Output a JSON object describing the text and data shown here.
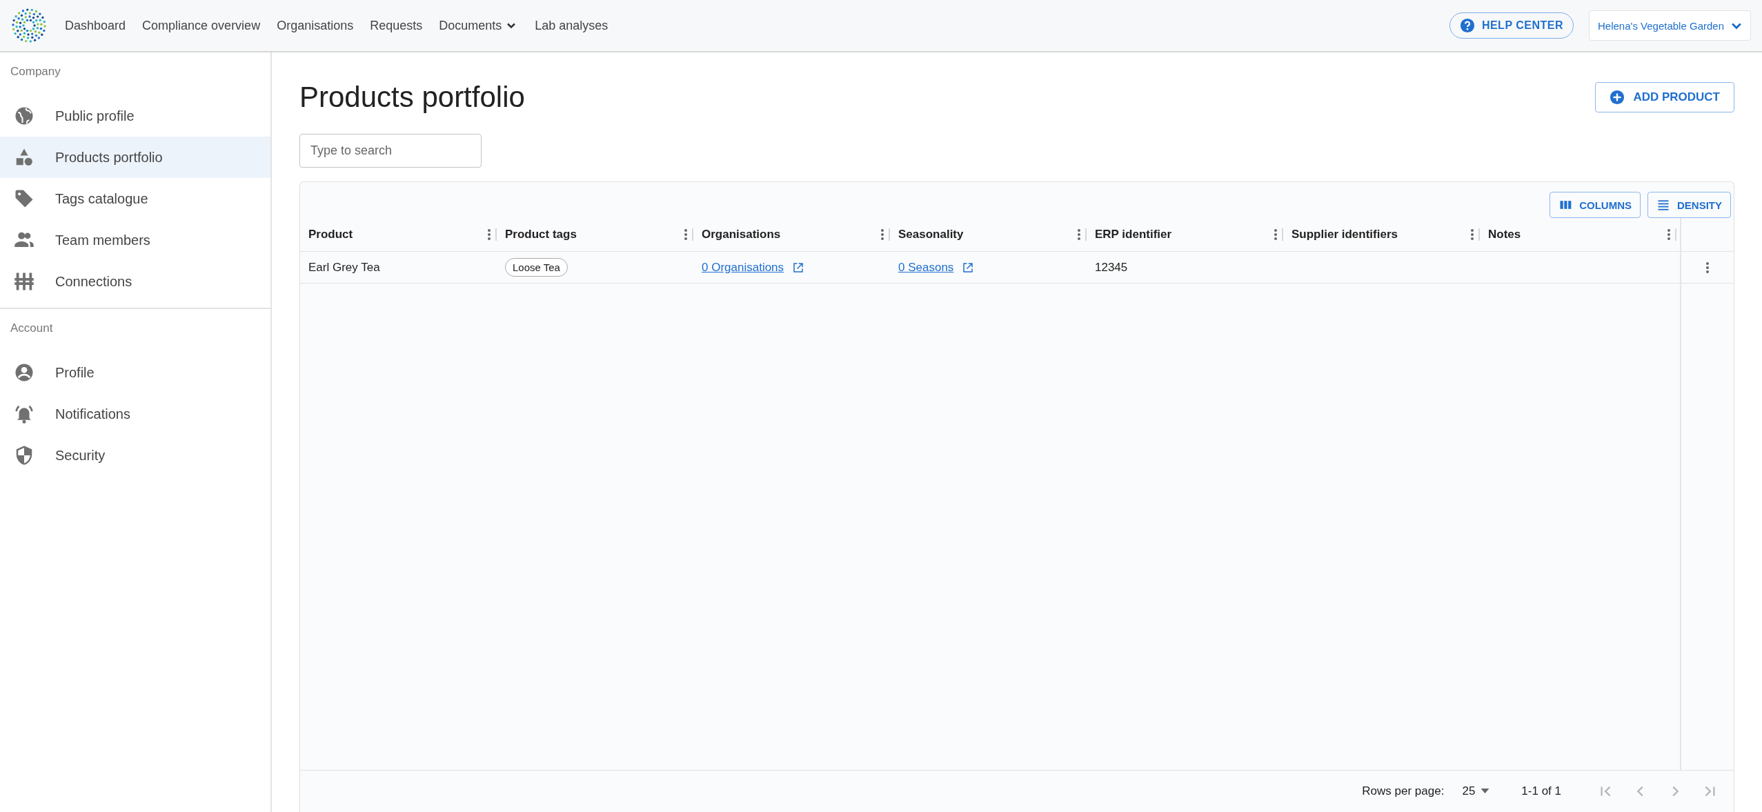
{
  "topbar": {
    "nav": [
      {
        "label": "Dashboard",
        "dropdown": false
      },
      {
        "label": "Compliance overview",
        "dropdown": false
      },
      {
        "label": "Organisations",
        "dropdown": false
      },
      {
        "label": "Requests",
        "dropdown": false
      },
      {
        "label": "Documents",
        "dropdown": true
      },
      {
        "label": "Lab analyses",
        "dropdown": false
      }
    ],
    "help": "HELP CENTER",
    "account": "Helena's Vegetable Garden"
  },
  "sidebar": {
    "sections": [
      {
        "title": "Company",
        "items": [
          {
            "label": "Public profile",
            "selected": false
          },
          {
            "label": "Products portfolio",
            "selected": true
          },
          {
            "label": "Tags catalogue",
            "selected": false
          },
          {
            "label": "Team members",
            "selected": false
          },
          {
            "label": "Connections",
            "selected": false
          }
        ]
      },
      {
        "title": "Account",
        "items": [
          {
            "label": "Profile",
            "selected": false
          },
          {
            "label": "Notifications",
            "selected": false
          },
          {
            "label": "Security",
            "selected": false
          }
        ]
      }
    ]
  },
  "page": {
    "title": "Products portfolio",
    "add_button": "ADD PRODUCT",
    "search": {
      "placeholder": "Type to search"
    }
  },
  "table": {
    "toolbar": [
      "COLUMNS",
      "DENSITY"
    ],
    "columns": [
      "Product",
      "Product tags",
      "Organisations",
      "Seasonality",
      "ERP identifier",
      "Supplier identifiers",
      "Notes"
    ],
    "rows": [
      {
        "cells": [
          {
            "kind": "text",
            "text": "Earl Grey Tea"
          },
          {
            "kind": "tag",
            "text": "Loose Tea"
          },
          {
            "kind": "link",
            "text": "0 Organisations"
          },
          {
            "kind": "link",
            "text": "0 Seasons"
          },
          {
            "kind": "text",
            "text": "12345"
          }
        ]
      }
    ],
    "footer": {
      "rows_label": "Rows per page:",
      "rows_value": "25",
      "range": "1-1 of 1",
      "pager": [
        {
          "disabled": true
        },
        {
          "disabled": true
        },
        {
          "disabled": true
        },
        {
          "disabled": true
        }
      ]
    }
  }
}
